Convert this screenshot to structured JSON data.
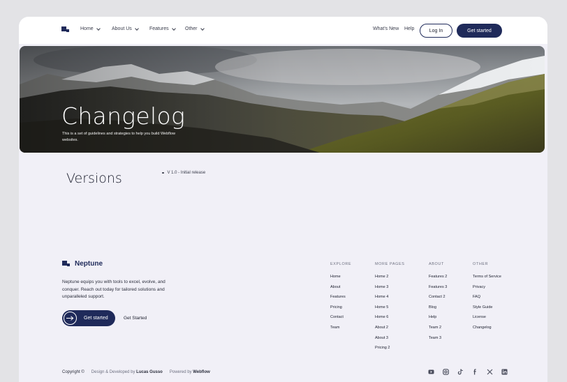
{
  "nav": {
    "items": [
      {
        "label": "Home"
      },
      {
        "label": "About Us"
      },
      {
        "label": "Features"
      },
      {
        "label": "Other"
      }
    ],
    "whats_new": "What's New",
    "help": "Help",
    "login": "Log In",
    "get_started": "Get started"
  },
  "hero": {
    "title": "Changelog",
    "subtitle": "This is a set of guidelines and strategies to help you build Webflow websites."
  },
  "versions": {
    "title": "Versions",
    "items": [
      "V 1.0 - Initial release"
    ]
  },
  "footer": {
    "brand": "Neptune",
    "description": "Neptune equips you with tools to excel, evolve, and conquer. Reach out today for tailored solutions and unparalleled support.",
    "cta": "Get started",
    "cta_secondary": "Get Started",
    "columns": [
      {
        "head": "EXPLORE",
        "items": [
          "Home",
          "About",
          "Features",
          "Pricing",
          "Contact",
          "Team"
        ]
      },
      {
        "head": "MORE PAGES",
        "items": [
          "Home 2",
          "Home 3",
          "Home 4",
          "Home 5",
          "Home 6",
          "About 2",
          "About 3",
          "Pricing 2"
        ]
      },
      {
        "head": "ABOUT",
        "items": [
          "Features 2",
          "Features 3",
          "Contact 2",
          "Blog",
          "Help",
          "Team 2",
          "Team 3"
        ]
      },
      {
        "head": "OTHER",
        "items": [
          "Terms of Service",
          "Privacy",
          "FAQ",
          "Style Guide",
          "License",
          "Changelog"
        ]
      }
    ],
    "copyright": "Copyright ©",
    "designed_prefix": "Design & Developed by",
    "designer": "Lucas Gusso",
    "powered_prefix": "Powered by",
    "powered": "Webflow",
    "socials": [
      "youtube-icon",
      "instagram-icon",
      "tiktok-icon",
      "facebook-icon",
      "x-icon",
      "linkedin-icon"
    ]
  },
  "colors": {
    "brand": "#1f2a5a",
    "page_bg": "#f1f0f7",
    "outer_bg": "#e3e3e6"
  }
}
